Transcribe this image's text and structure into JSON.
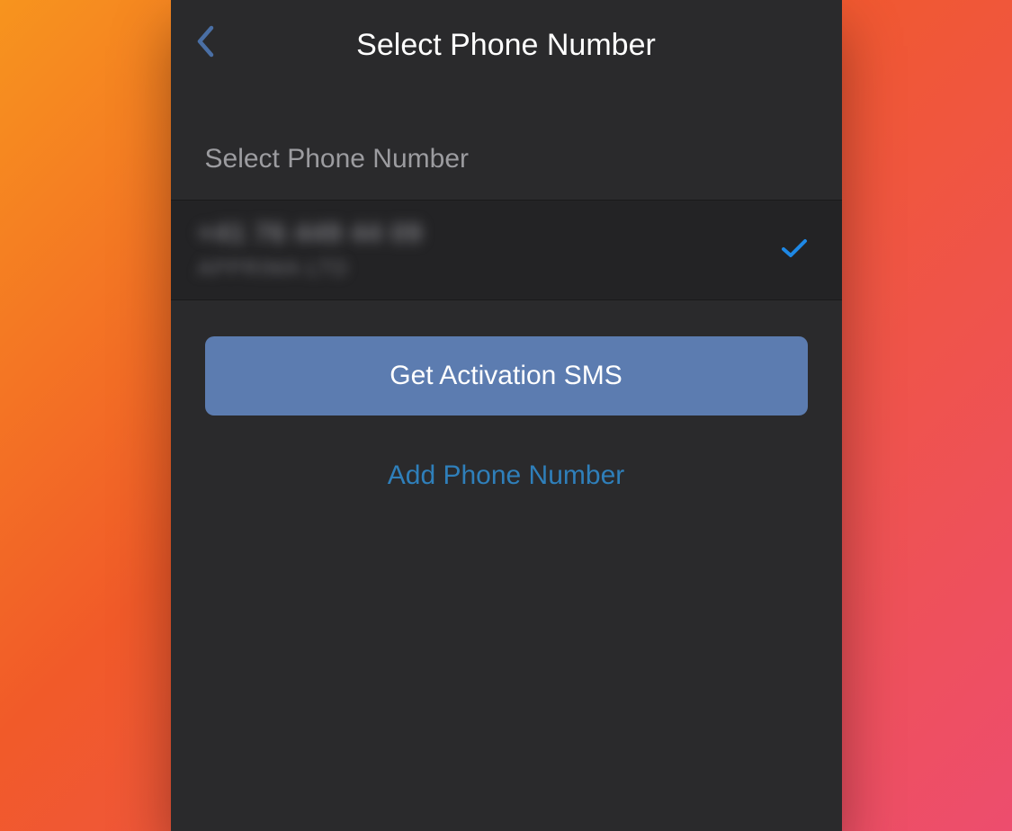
{
  "header": {
    "title": "Select Phone Number"
  },
  "section": {
    "label": "Select Phone Number"
  },
  "phone": {
    "number": "+41 76 449 44 09",
    "carrier": "APPRIMA LTD",
    "selected": true
  },
  "actions": {
    "primary_label": "Get Activation SMS",
    "add_label": "Add Phone Number"
  }
}
